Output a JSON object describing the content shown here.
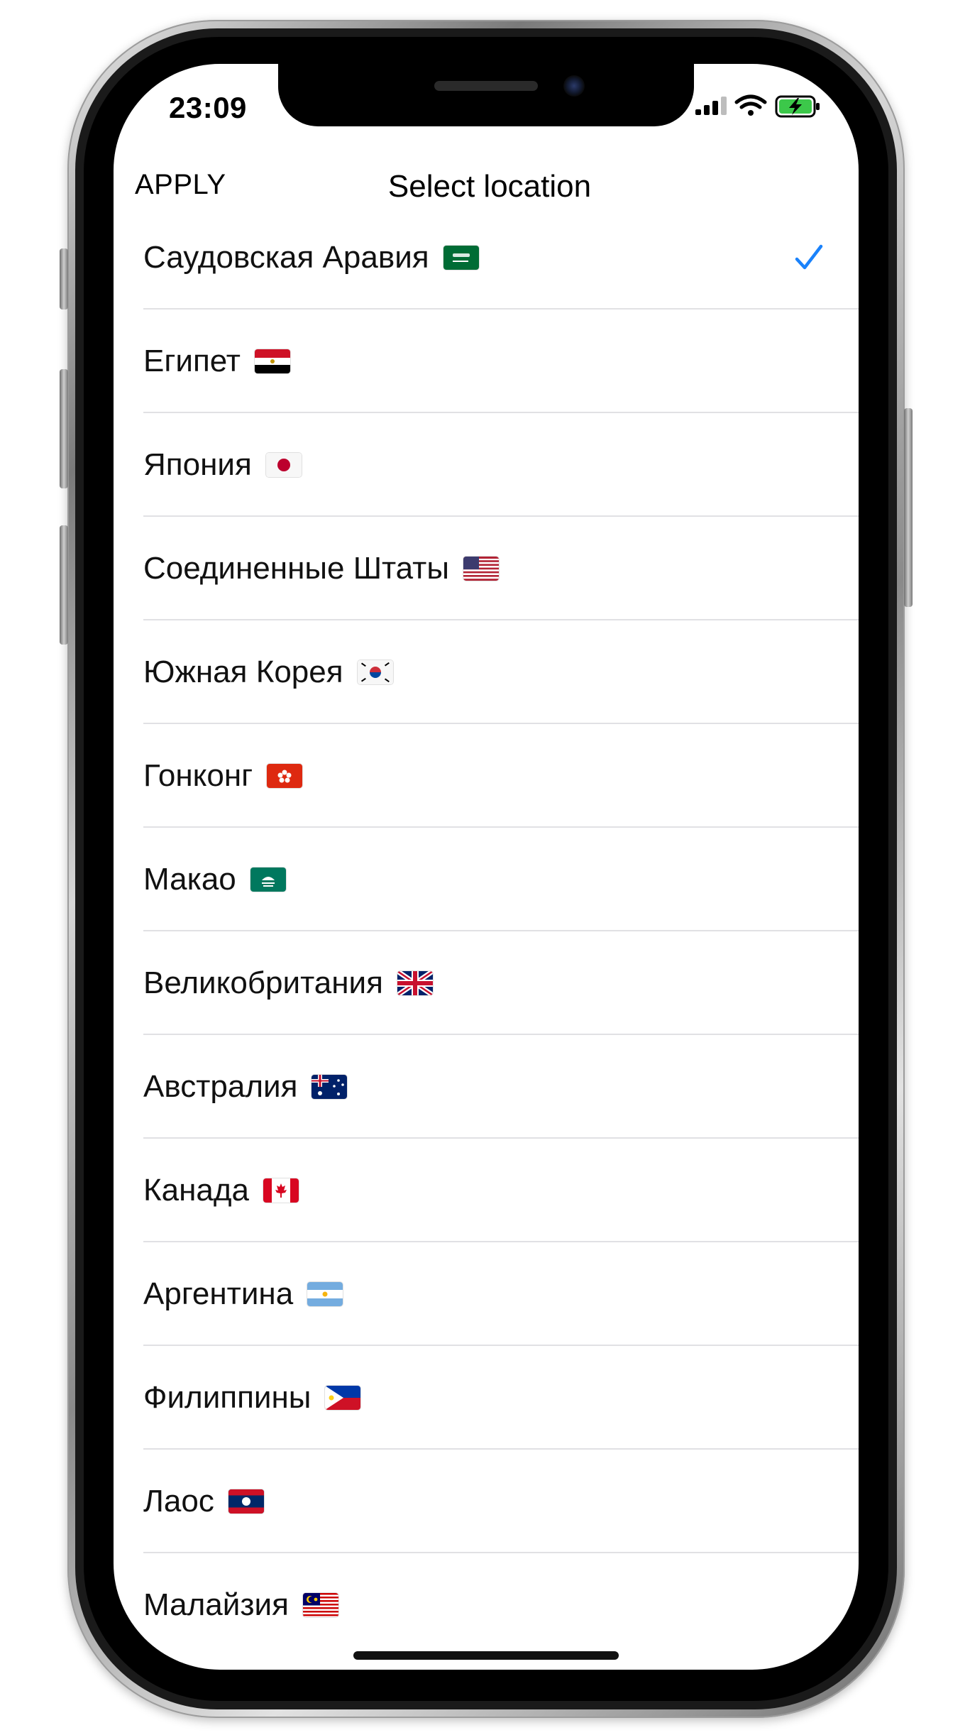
{
  "status_bar": {
    "time": "23:09"
  },
  "nav": {
    "apply_label": "APPLY",
    "title": "Select location"
  },
  "accent_color": "#1a82fb",
  "locations": [
    {
      "label": "Саудовская Аравия",
      "flag": "saudi-arabia-flag-icon",
      "selected": true
    },
    {
      "label": "Египет",
      "flag": "egypt-flag-icon",
      "selected": false
    },
    {
      "label": "Япония",
      "flag": "japan-flag-icon",
      "selected": false
    },
    {
      "label": "Соединенные Штаты",
      "flag": "usa-flag-icon",
      "selected": false
    },
    {
      "label": "Южная Корея",
      "flag": "south-korea-flag-icon",
      "selected": false
    },
    {
      "label": "Гонконг",
      "flag": "hong-kong-flag-icon",
      "selected": false
    },
    {
      "label": "Макао",
      "flag": "macau-flag-icon",
      "selected": false
    },
    {
      "label": "Великобритания",
      "flag": "uk-flag-icon",
      "selected": false
    },
    {
      "label": "Австралия",
      "flag": "australia-flag-icon",
      "selected": false
    },
    {
      "label": "Канада",
      "flag": "canada-flag-icon",
      "selected": false
    },
    {
      "label": "Аргентина",
      "flag": "argentina-flag-icon",
      "selected": false
    },
    {
      "label": "Филиппины",
      "flag": "philippines-flag-icon",
      "selected": false
    },
    {
      "label": "Лаос",
      "flag": "laos-flag-icon",
      "selected": false
    },
    {
      "label": "Малайзия",
      "flag": "malaysia-flag-icon",
      "selected": false
    }
  ]
}
